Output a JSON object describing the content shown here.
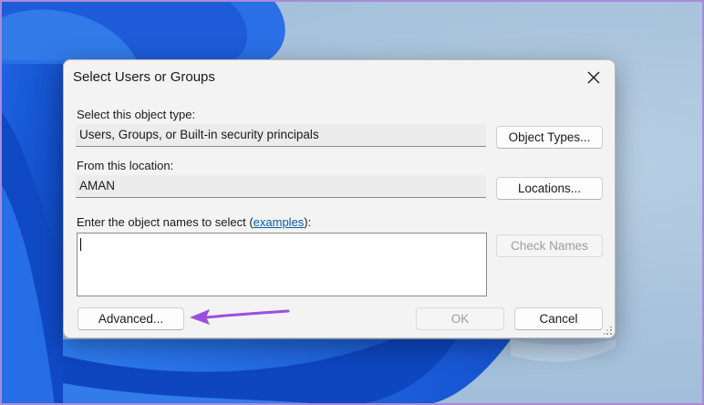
{
  "dialog": {
    "title": "Select Users or Groups",
    "object_type_label": "Select this object type:",
    "object_type_value": "Users, Groups, or Built-in security principals",
    "object_types_button": "Object Types...",
    "location_label": "From this location:",
    "location_value": "AMAN",
    "locations_button": "Locations...",
    "enter_names_label_prefix": "Enter the object names to select (",
    "enter_names_link": "examples",
    "enter_names_label_suffix": "):",
    "names_input_value": "",
    "check_names_button": "Check Names",
    "advanced_button": "Advanced...",
    "ok_button": "OK",
    "cancel_button": "Cancel"
  },
  "colors": {
    "annotation_arrow": "#9b4fe0",
    "frame_border": "#a78bd8",
    "link": "#0b5ea8"
  },
  "icons": [
    "close-icon",
    "resize-grip-icon",
    "annotation-arrow-icon"
  ]
}
